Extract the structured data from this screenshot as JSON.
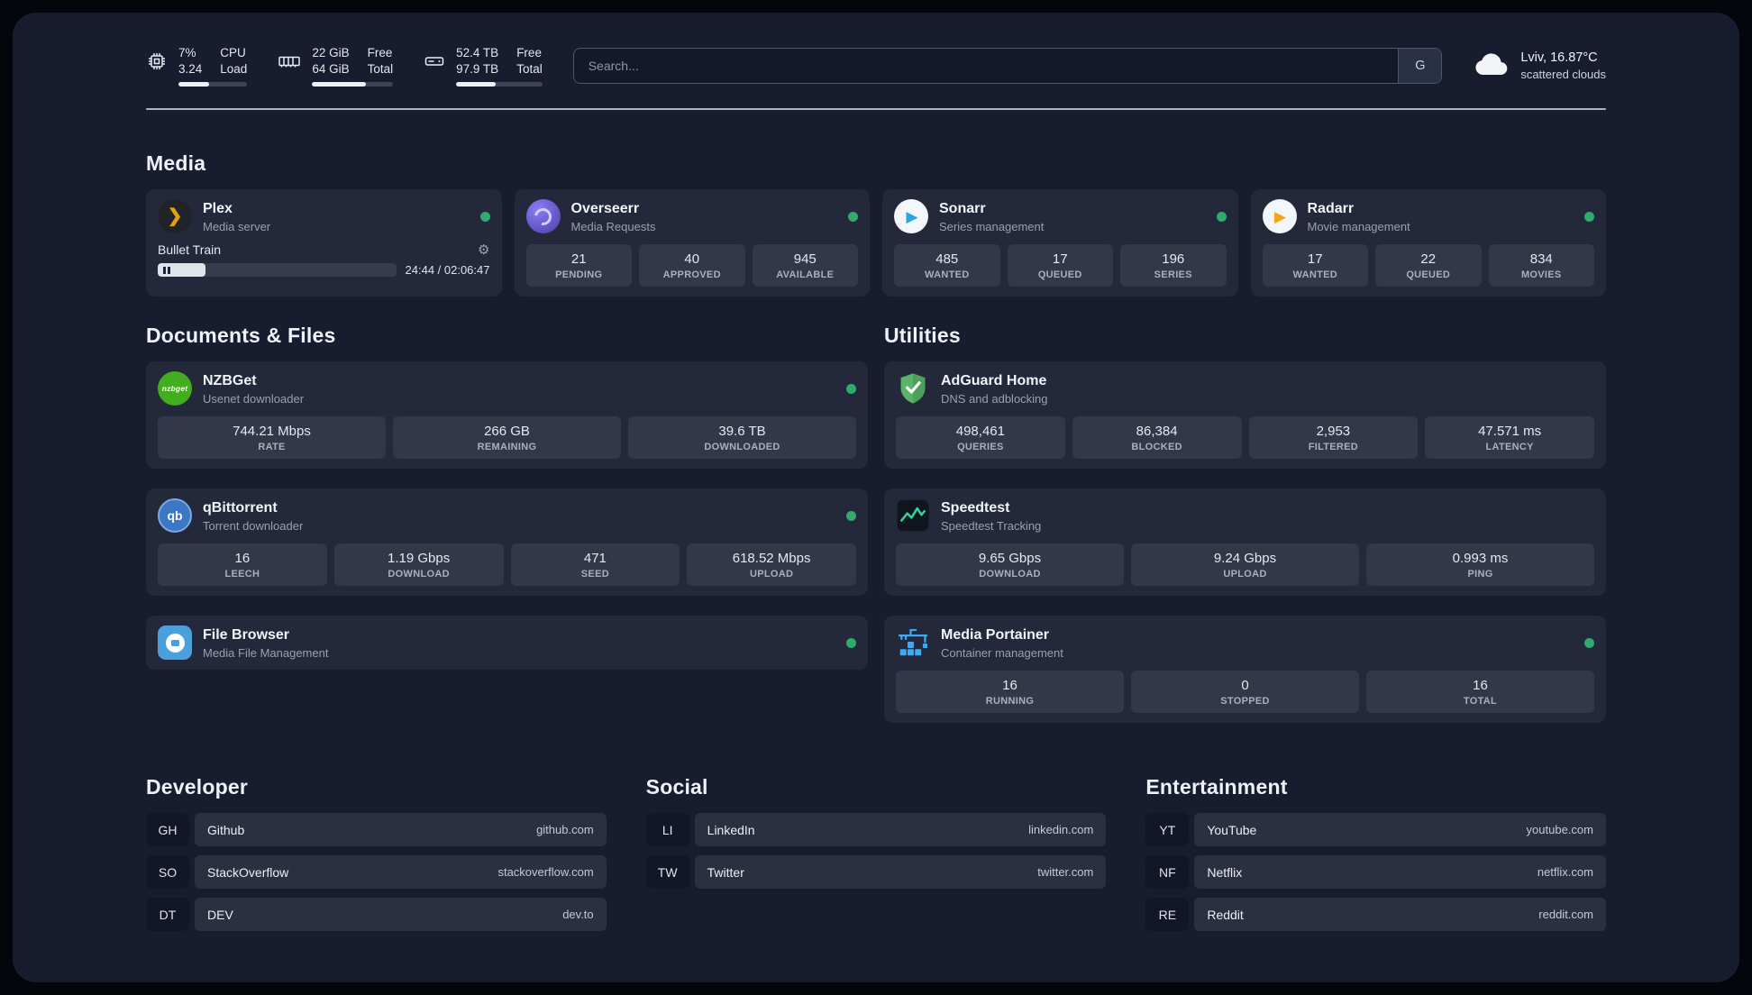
{
  "topbar": {
    "cpu": {
      "value_top": "7%",
      "value_bottom": "3.24",
      "label_top": "CPU",
      "label_bottom": "Load",
      "bar": 45
    },
    "memory": {
      "value_top": "22 GiB",
      "value_bottom": "64 GiB",
      "label_top": "Free",
      "label_bottom": "Total",
      "bar": 66
    },
    "disk": {
      "value_top": "52.4 TB",
      "value_bottom": "97.9 TB",
      "label_top": "Free",
      "label_bottom": "Total",
      "bar": 46
    },
    "search": {
      "placeholder": "Search...",
      "button": "G"
    },
    "weather": {
      "location": "Lviv, 16.87°C",
      "condition": "scattered clouds"
    }
  },
  "sections": {
    "media": {
      "title": "Media",
      "plex": {
        "title": "Plex",
        "subtitle": "Media server",
        "now_playing": "Bullet Train",
        "time": "24:44 / 02:06:47",
        "progress": 20
      },
      "overseerr": {
        "title": "Overseerr",
        "subtitle": "Media Requests",
        "stats": [
          {
            "value": "21",
            "label": "PENDING"
          },
          {
            "value": "40",
            "label": "APPROVED"
          },
          {
            "value": "945",
            "label": "AVAILABLE"
          }
        ]
      },
      "sonarr": {
        "title": "Sonarr",
        "subtitle": "Series management",
        "stats": [
          {
            "value": "485",
            "label": "WANTED"
          },
          {
            "value": "17",
            "label": "QUEUED"
          },
          {
            "value": "196",
            "label": "SERIES"
          }
        ]
      },
      "radarr": {
        "title": "Radarr",
        "subtitle": "Movie management",
        "stats": [
          {
            "value": "17",
            "label": "WANTED"
          },
          {
            "value": "22",
            "label": "QUEUED"
          },
          {
            "value": "834",
            "label": "MOVIES"
          }
        ]
      }
    },
    "documents": {
      "title": "Documents & Files",
      "nzbget": {
        "title": "NZBGet",
        "subtitle": "Usenet downloader",
        "icon_text": "nzbget",
        "stats": [
          {
            "value": "744.21 Mbps",
            "label": "RATE"
          },
          {
            "value": "266 GB",
            "label": "REMAINING"
          },
          {
            "value": "39.6 TB",
            "label": "DOWNLOADED"
          }
        ]
      },
      "qbittorrent": {
        "title": "qBittorrent",
        "subtitle": "Torrent downloader",
        "icon_text": "qb",
        "stats": [
          {
            "value": "16",
            "label": "LEECH"
          },
          {
            "value": "1.19 Gbps",
            "label": "DOWNLOAD"
          },
          {
            "value": "471",
            "label": "SEED"
          },
          {
            "value": "618.52 Mbps",
            "label": "UPLOAD"
          }
        ]
      },
      "filebrowser": {
        "title": "File Browser",
        "subtitle": "Media File Management"
      }
    },
    "utilities": {
      "title": "Utilities",
      "adguard": {
        "title": "AdGuard Home",
        "subtitle": "DNS and adblocking",
        "stats": [
          {
            "value": "498,461",
            "label": "QUERIES"
          },
          {
            "value": "86,384",
            "label": "BLOCKED"
          },
          {
            "value": "2,953",
            "label": "FILTERED"
          },
          {
            "value": "47.571 ms",
            "label": "LATENCY"
          }
        ]
      },
      "speedtest": {
        "title": "Speedtest",
        "subtitle": "Speedtest Tracking",
        "stats": [
          {
            "value": "9.65 Gbps",
            "label": "DOWNLOAD"
          },
          {
            "value": "9.24 Gbps",
            "label": "UPLOAD"
          },
          {
            "value": "0.993 ms",
            "label": "PING"
          }
        ]
      },
      "portainer": {
        "title": "Media Portainer",
        "subtitle": "Container management",
        "stats": [
          {
            "value": "16",
            "label": "RUNNING"
          },
          {
            "value": "0",
            "label": "STOPPED"
          },
          {
            "value": "16",
            "label": "TOTAL"
          }
        ]
      }
    }
  },
  "bookmarks": [
    {
      "title": "Developer",
      "items": [
        {
          "abbr": "GH",
          "name": "Github",
          "domain": "github.com"
        },
        {
          "abbr": "SO",
          "name": "StackOverflow",
          "domain": "stackoverflow.com"
        },
        {
          "abbr": "DT",
          "name": "DEV",
          "domain": "dev.to"
        }
      ]
    },
    {
      "title": "Social",
      "items": [
        {
          "abbr": "LI",
          "name": "LinkedIn",
          "domain": "linkedin.com"
        },
        {
          "abbr": "TW",
          "name": "Twitter",
          "domain": "twitter.com"
        }
      ]
    },
    {
      "title": "Entertainment",
      "items": [
        {
          "abbr": "YT",
          "name": "YouTube",
          "domain": "youtube.com"
        },
        {
          "abbr": "NF",
          "name": "Netflix",
          "domain": "netflix.com"
        },
        {
          "abbr": "RE",
          "name": "Reddit",
          "domain": "reddit.com"
        }
      ]
    }
  ],
  "colors": {
    "accent_green": "#2fab6e",
    "panel_bg": "#171d2f"
  }
}
